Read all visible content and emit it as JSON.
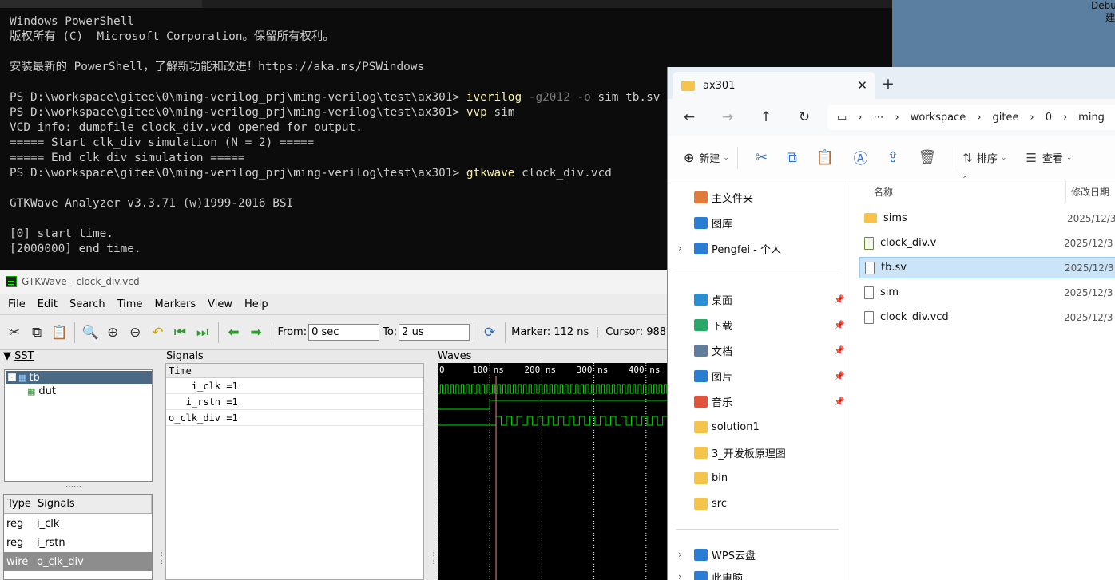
{
  "desktop": {
    "debug_hint": "Debu\n建"
  },
  "powershell": {
    "lines": [
      {
        "t": "Windows PowerShell"
      },
      {
        "t": "版权所有 (C)  Microsoft Corporation。保留所有权利。"
      },
      {
        "t": ""
      },
      {
        "t": "安装最新的 PowerShell，了解新功能和改进！https://aka.ms/PSWindows"
      },
      {
        "t": ""
      },
      {
        "prompt": "PS D:\\workspace\\gitee\\0\\ming-verilog_prj\\ming-verilog\\test\\ax301> ",
        "cmd": "iverilog",
        "args": " -g2012 -o",
        "rest": " sim tb.sv"
      },
      {
        "prompt": "PS D:\\workspace\\gitee\\0\\ming-verilog_prj\\ming-verilog\\test\\ax301> ",
        "cmd": "vvp",
        "args": "",
        "rest": " sim"
      },
      {
        "t": "VCD info: dumpfile clock_div.vcd opened for output."
      },
      {
        "t": "===== Start clk_div simulation (N = 2) ====="
      },
      {
        "t": "===== End clk_div simulation ====="
      },
      {
        "prompt": "PS D:\\workspace\\gitee\\0\\ming-verilog_prj\\ming-verilog\\test\\ax301> ",
        "cmd": "gtkwave",
        "args": "",
        "rest": " clock_div.vcd"
      },
      {
        "t": ""
      },
      {
        "t": "GTKWave Analyzer v3.3.71 (w)1999-2016 BSI"
      },
      {
        "t": ""
      },
      {
        "t": "[0] start time."
      },
      {
        "t": "[2000000] end time."
      }
    ]
  },
  "gtkwave": {
    "title": "GTKWave - clock_div.vcd",
    "menu": [
      "File",
      "Edit",
      "Search",
      "Time",
      "Markers",
      "View",
      "Help"
    ],
    "from_label": "From:",
    "from_value": "0 sec",
    "to_label": "To:",
    "to_value": "2 us",
    "marker_cursor": "Marker: 112 ns  |  Cursor: 988",
    "sst_label": "SST",
    "signals_label": "Signals",
    "waves_label": "Waves",
    "tree": [
      {
        "name": "tb"
      },
      {
        "name": "dut"
      }
    ],
    "typesig_header": {
      "type": "Type",
      "signals": "Signals"
    },
    "typesig_rows": [
      {
        "type": "reg",
        "name": "i_clk"
      },
      {
        "type": "reg",
        "name": "i_rstn"
      },
      {
        "type": "wire",
        "name": "o_clk_div"
      }
    ],
    "signal_list_header": "Time",
    "signal_list": [
      "    i_clk =1",
      "   i_rstn =1",
      "o_clk_div =1"
    ],
    "time_ticks": [
      "0",
      "100 ns",
      "200 ns",
      "300 ns",
      "400 ns"
    ],
    "wave_colors": {
      "trace": "#00e000",
      "marker": "#ff8080",
      "grid": "#ffffff"
    }
  },
  "explorer": {
    "tab_title": "ax301",
    "breadcrumbs": [
      "workspace",
      "gitee",
      "0",
      "ming"
    ],
    "commands": {
      "new": "新建",
      "sort": "排序",
      "view": "查看"
    },
    "nav_top": [
      {
        "label": "主文件夹",
        "icon": "home-icon"
      },
      {
        "label": "图库",
        "icon": "gallery-icon"
      },
      {
        "label": "Pengfei - 个人",
        "icon": "onedrive-icon"
      }
    ],
    "nav_quick": [
      {
        "label": "桌面",
        "icon": "desktop-icon"
      },
      {
        "label": "下载",
        "icon": "download-icon"
      },
      {
        "label": "文档",
        "icon": "document-icon"
      },
      {
        "label": "图片",
        "icon": "pictures-icon"
      },
      {
        "label": "音乐",
        "icon": "music-icon"
      },
      {
        "label": "solution1",
        "icon": "folder-icon"
      },
      {
        "label": "3_开发板原理图",
        "icon": "folder-icon"
      },
      {
        "label": "bin",
        "icon": "folder-icon"
      },
      {
        "label": "src",
        "icon": "folder-icon"
      }
    ],
    "nav_bottom": [
      {
        "label": "WPS云盘",
        "icon": "cloud-icon"
      },
      {
        "label": "此电脑",
        "icon": "computer-icon"
      }
    ],
    "columns": {
      "name": "名称",
      "date": "修改日期"
    },
    "files": [
      {
        "name": "sims",
        "date": "2025/12/3",
        "kind": "folder"
      },
      {
        "name": "clock_div.v",
        "date": "2025/12/3",
        "kind": "verilog"
      },
      {
        "name": "tb.sv",
        "date": "2025/12/3",
        "kind": "file"
      },
      {
        "name": "sim",
        "date": "2025/12/3",
        "kind": "file"
      },
      {
        "name": "clock_div.vcd",
        "date": "2025/12/3",
        "kind": "file"
      }
    ]
  }
}
